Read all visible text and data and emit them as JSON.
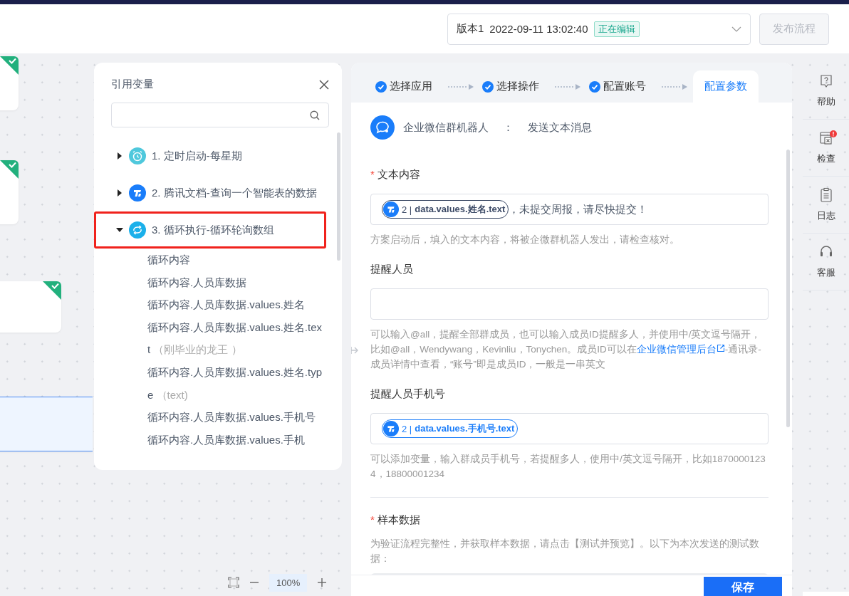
{
  "header": {
    "version": "版本1",
    "datetime": "2022-09-11 13:02:40",
    "status": "正在编辑",
    "publish_button": {
      "label": "发布流程",
      "disabled": true
    }
  },
  "canvas": {
    "nodes": [
      {
        "done": true,
        "selected": false
      },
      {
        "done": true,
        "selected": false
      },
      {
        "done": true,
        "selected": false
      },
      {
        "done": false,
        "selected": true
      }
    ],
    "zoom": "100%"
  },
  "variables": {
    "title": "引用变量",
    "groups": [
      {
        "label": "1. 定时启动-每星期",
        "kind": "timer",
        "color": "#4fc8dc",
        "expanded": false,
        "highlighted": false
      },
      {
        "label": "2. 腾讯文档-查询一个智能表的数据",
        "kind": "doc",
        "color": "#1a7dfa",
        "expanded": false,
        "highlighted": false
      },
      {
        "label": "3. 循环执行-循环轮询数组",
        "kind": "loop",
        "color": "#1bb0ea",
        "expanded": true,
        "highlighted": true,
        "children": [
          {
            "label": "循环内容"
          },
          {
            "label": "循环内容.人员库数据"
          },
          {
            "label": "循环内容.人员库数据.values.姓名"
          },
          {
            "label": "循环内容.人员库数据.values.姓名.text",
            "sample": "（刚毕业的龙王 ）"
          },
          {
            "label": "循环内容.人员库数据.values.姓名.type",
            "sample": "（text)"
          },
          {
            "label": "循环内容.人员库数据.values.手机号"
          },
          {
            "label": "循环内容.人员库数据.values.手机"
          }
        ]
      }
    ]
  },
  "config": {
    "steps": [
      {
        "label": "选择应用",
        "done": true,
        "selected": false
      },
      {
        "label": "选择操作",
        "done": true,
        "selected": false
      },
      {
        "label": "配置账号",
        "done": true,
        "selected": false
      },
      {
        "label": "配置参数",
        "done": false,
        "selected": true
      }
    ],
    "app": {
      "name": "企业微信群机器人",
      "separator": "：",
      "action": "发送文本消息"
    },
    "fields": [
      {
        "label": "文本内容",
        "required_mark": "*",
        "kind": "tokens",
        "tokens": [
          {
            "step": "2 |",
            "path": "data.values.姓名.text",
            "active": false
          }
        ],
        "text": "，未提交周报，请尽快提交！",
        "help": "方案启动后，填入的文本内容，将被企微群机器人发出，请检查核对。"
      },
      {
        "label": "提醒人员",
        "kind": "empty",
        "help": "可以输入@all，提醒全部群成员，也可以输入成员ID提醒多人，并使用中/英文逗号隔开，比如@all，Wendywang，Kevinliu，Tonychen。成员ID可以在",
        "link": "企业微信管理后台",
        "help_after": "-通讯录-成员详情中查看，“账号”即是成员ID，一般是一串英文"
      },
      {
        "label": "提醒人员手机号",
        "kind": "tokens",
        "tokens": [
          {
            "step": "2 |",
            "path": "data.values.手机号.text",
            "active": true
          }
        ],
        "help": "可以添加变量，输入群成员手机号，若提醒多人，使用中/英文逗号隔开，比如18700001234，18800001234"
      },
      {
        "label": "样本数据",
        "required_mark": "*",
        "kind": "sample",
        "help": "为验证流程完整性，并获取样本数据，请点击【测试并预览】。以下为本次发送的测试数据："
      }
    ],
    "save_button": "保存"
  },
  "sidebar": [
    {
      "label": "帮助",
      "kind": "help",
      "alert": false
    },
    {
      "label": "检查",
      "kind": "check",
      "alert": true
    },
    {
      "label": "日志",
      "kind": "log",
      "alert": false
    },
    {
      "label": "客服",
      "kind": "service",
      "alert": false
    }
  ]
}
